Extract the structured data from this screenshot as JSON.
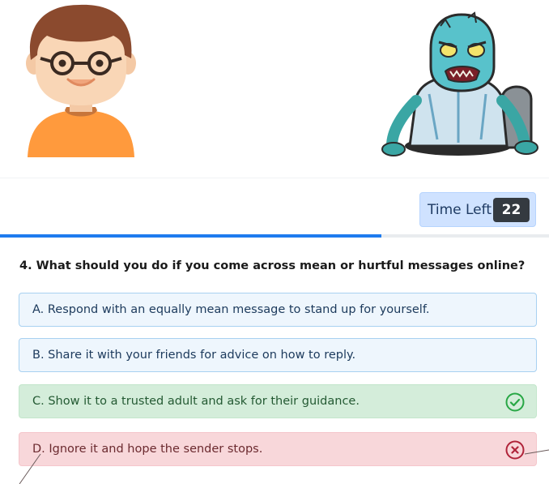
{
  "timer": {
    "label": "Time Left",
    "value": "22"
  },
  "progress": {
    "fraction": 0.694,
    "color": "#1e7bef"
  },
  "question": {
    "text": "4. What should you do if you come across mean or hurtful messages online?"
  },
  "options": [
    {
      "text": "A. Respond with an equally mean message to stand up for yourself.",
      "state": "neutral"
    },
    {
      "text": "B. Share it with your friends for advice on how to reply.",
      "state": "neutral"
    },
    {
      "text": "C. Show it to a trusted adult and ask for their guidance.",
      "state": "correct",
      "icon": "check-circle-icon"
    },
    {
      "text": "D. Ignore it and hope the sender stops.",
      "state": "wrong",
      "icon": "x-circle-icon"
    }
  ],
  "colors": {
    "correct": "#28a745",
    "wrong": "#b0243a",
    "timer_bg": "#cfe2ff",
    "timer_badge": "#343a40"
  }
}
